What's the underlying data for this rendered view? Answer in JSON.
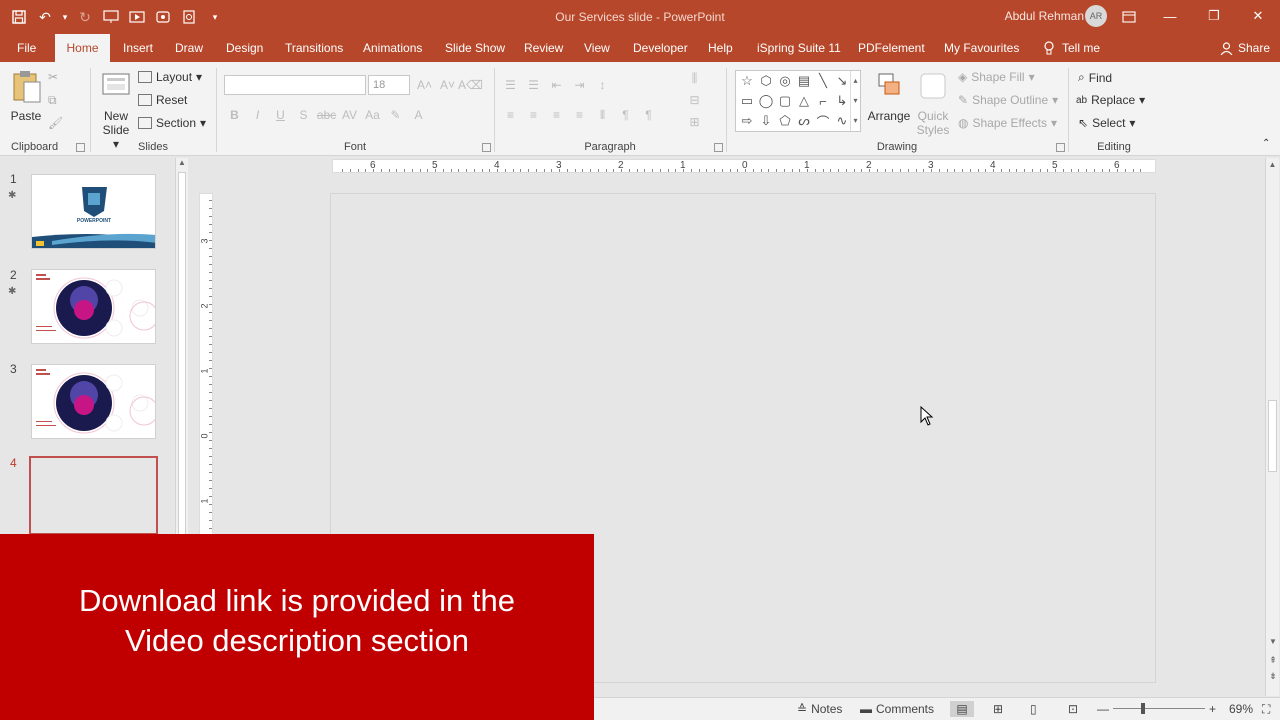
{
  "titlebar": {
    "doc_title": "Our Services slide  -  PowerPoint",
    "user_name": "Abdul Rehman",
    "user_initials": "AR",
    "minimize": "—",
    "restore": "❐",
    "close": "✕"
  },
  "tabs": [
    {
      "label": "File",
      "active": false
    },
    {
      "label": "Home",
      "active": true
    },
    {
      "label": "Insert",
      "active": false
    },
    {
      "label": "Draw",
      "active": false
    },
    {
      "label": "Design",
      "active": false
    },
    {
      "label": "Transitions",
      "active": false
    },
    {
      "label": "Animations",
      "active": false
    },
    {
      "label": "Slide Show",
      "active": false
    },
    {
      "label": "Review",
      "active": false
    },
    {
      "label": "View",
      "active": false
    },
    {
      "label": "Developer",
      "active": false
    },
    {
      "label": "Help",
      "active": false
    },
    {
      "label": "iSpring Suite 11",
      "active": false
    },
    {
      "label": "PDFelement",
      "active": false
    },
    {
      "label": "My Favourites",
      "active": false
    }
  ],
  "tell_me": "Tell me",
  "share": "Share",
  "ribbon": {
    "clipboard": {
      "label": "Clipboard",
      "paste": "Paste"
    },
    "slides": {
      "label": "Slides",
      "new_slide_1": "New",
      "new_slide_2": "Slide",
      "layout": "Layout",
      "reset": "Reset",
      "section": "Section"
    },
    "font": {
      "label": "Font",
      "font_name": "",
      "font_size": "18"
    },
    "paragraph": {
      "label": "Paragraph"
    },
    "drawing": {
      "label": "Drawing",
      "arrange": "Arrange",
      "quick_styles_1": "Quick",
      "quick_styles_2": "Styles",
      "shape_fill": "Shape Fill",
      "shape_outline": "Shape Outline",
      "shape_effects": "Shape Effects"
    },
    "editing": {
      "label": "Editing",
      "find": "Find",
      "replace": "Replace",
      "select": "Select"
    }
  },
  "thumbnails": [
    {
      "num": "1",
      "star": true,
      "caption": "POWERPOINT"
    },
    {
      "num": "2",
      "star": true,
      "caption": ""
    },
    {
      "num": "3",
      "star": false,
      "caption": ""
    },
    {
      "num": "4",
      "star": false,
      "caption": "",
      "selected": true
    }
  ],
  "hruler_labels": [
    "6",
    "5",
    "4",
    "3",
    "2",
    "1",
    "0",
    "1",
    "2",
    "3",
    "4",
    "5",
    "6"
  ],
  "vruler_labels": [
    "3",
    "2",
    "1",
    "0",
    "1"
  ],
  "statusbar": {
    "notes": "Notes",
    "comments": "Comments",
    "zoom": "69%"
  },
  "banner": {
    "line1": "Download link is provided in the",
    "line2": "Video description section"
  }
}
